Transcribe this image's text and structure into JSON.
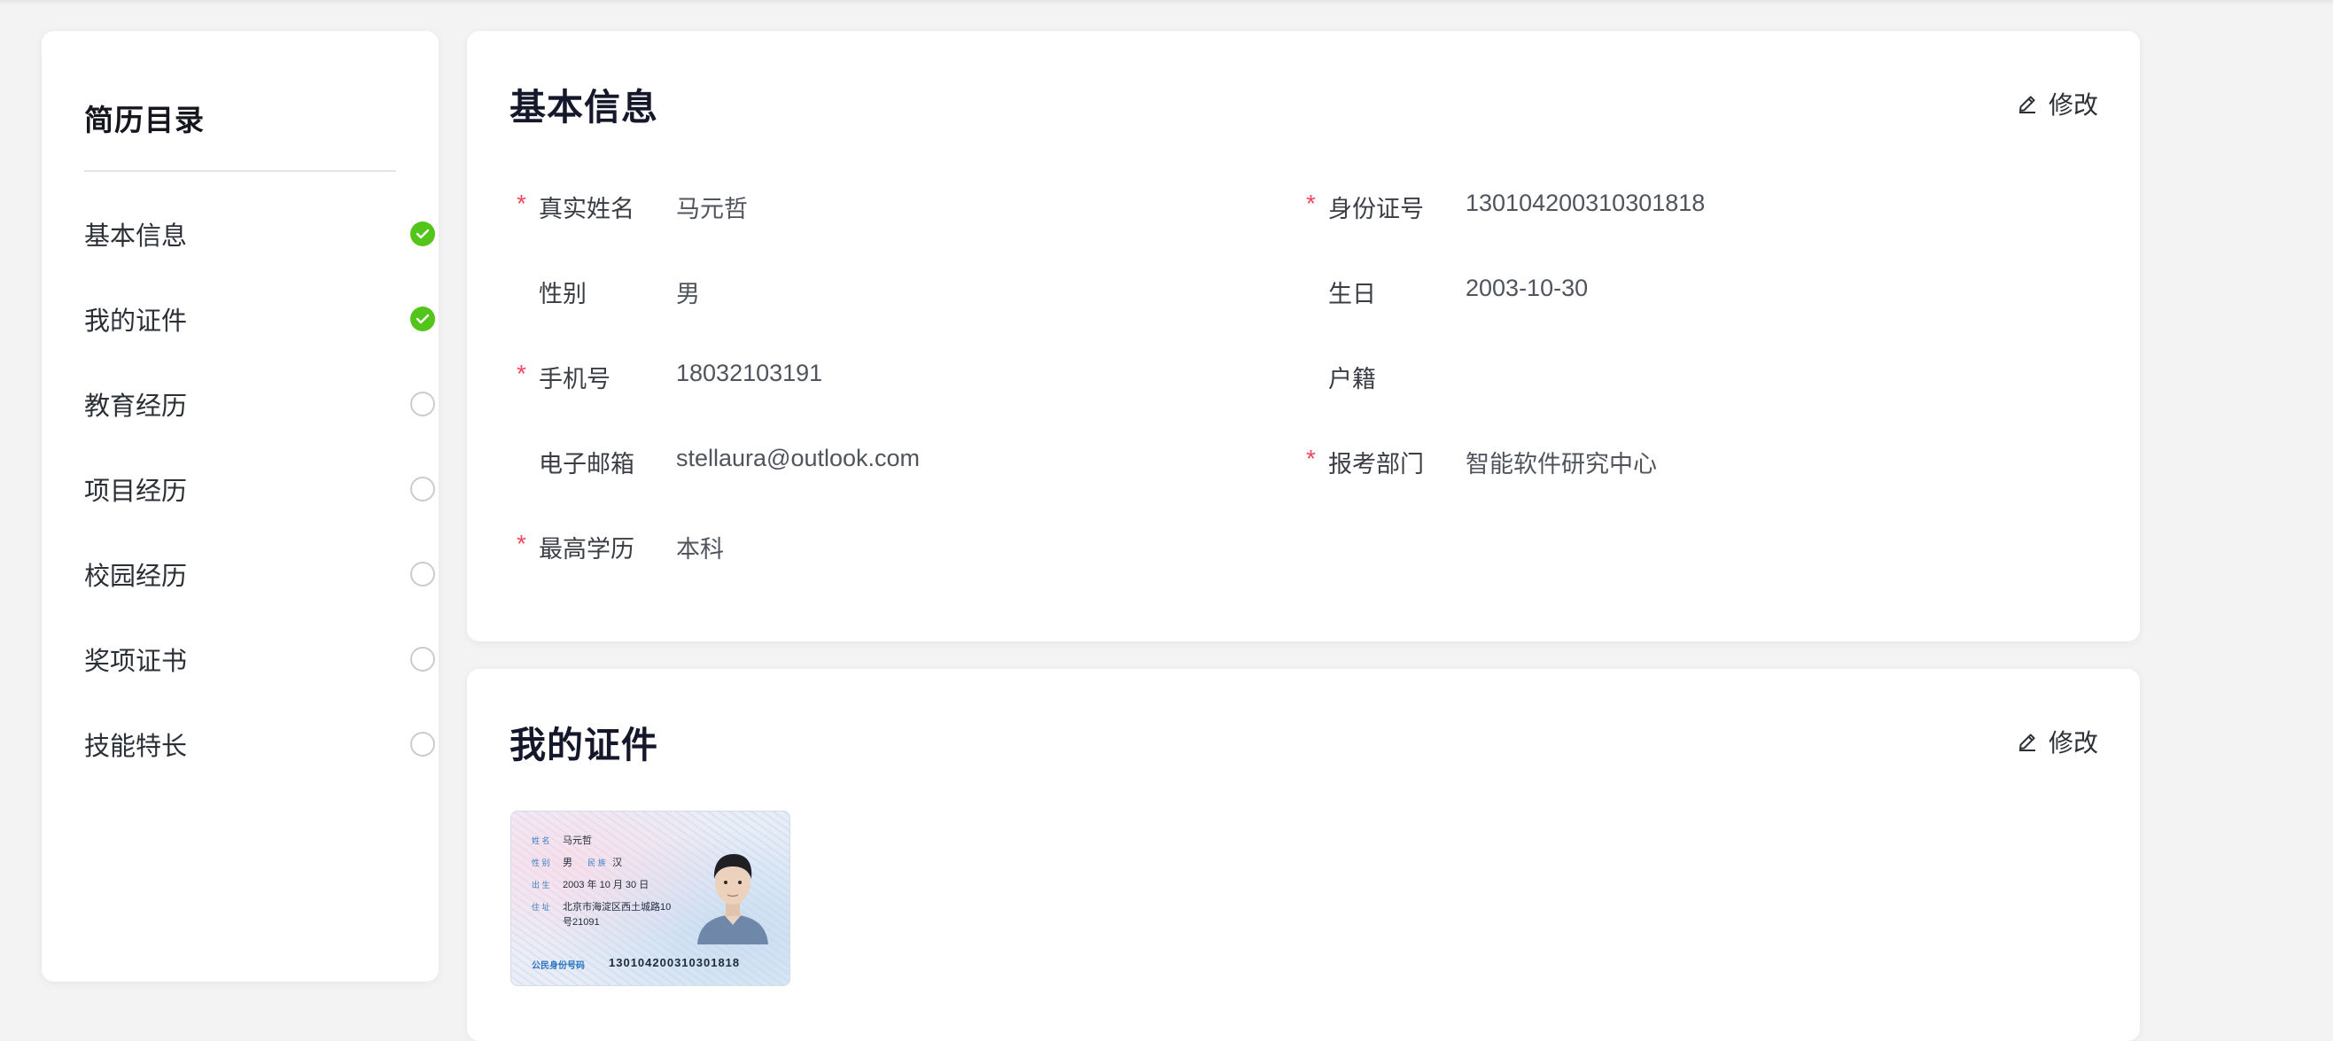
{
  "sidebar": {
    "title": "简历目录",
    "items": [
      {
        "label": "基本信息",
        "status": "done"
      },
      {
        "label": "我的证件",
        "status": "done"
      },
      {
        "label": "教育经历",
        "status": "todo"
      },
      {
        "label": "项目经历",
        "status": "todo"
      },
      {
        "label": "校园经历",
        "status": "todo"
      },
      {
        "label": "奖项证书",
        "status": "todo"
      },
      {
        "label": "技能特长",
        "status": "todo"
      }
    ]
  },
  "basic_info": {
    "title": "基本信息",
    "edit_label": "修改",
    "fields": [
      {
        "label": "真实姓名",
        "value": "马元哲",
        "required": true
      },
      {
        "label": "身份证号",
        "value": "130104200310301818",
        "required": true
      },
      {
        "label": "性别",
        "value": "男",
        "required": false
      },
      {
        "label": "生日",
        "value": "2003-10-30",
        "required": false
      },
      {
        "label": "手机号",
        "value": "18032103191",
        "required": true
      },
      {
        "label": "户籍",
        "value": "",
        "required": false
      },
      {
        "label": "电子邮箱",
        "value": "stellaura@outlook.com",
        "required": false
      },
      {
        "label": "报考部门",
        "value": "智能软件研究中心",
        "required": true
      },
      {
        "label": "最高学历",
        "value": "本科",
        "required": true
      }
    ]
  },
  "certificates": {
    "title": "我的证件",
    "edit_label": "修改",
    "id_card": {
      "name_label": "姓 名",
      "name": "马元哲",
      "gender_label": "性 别",
      "gender": "男",
      "ethnicity_label": "民 族",
      "ethnicity": "汉",
      "birth_label": "出 生",
      "birth": "2003 年 10 月 30 日",
      "address_label": "住 址",
      "address_line1": "北京市海淀区西土城路10",
      "address_line2": "号21091",
      "number_label": "公民身份号码",
      "number": "130104200310301818"
    }
  },
  "colors": {
    "accent_done": "#52c41a",
    "required_star": "#f5455c",
    "background": "#f3f3f4"
  }
}
